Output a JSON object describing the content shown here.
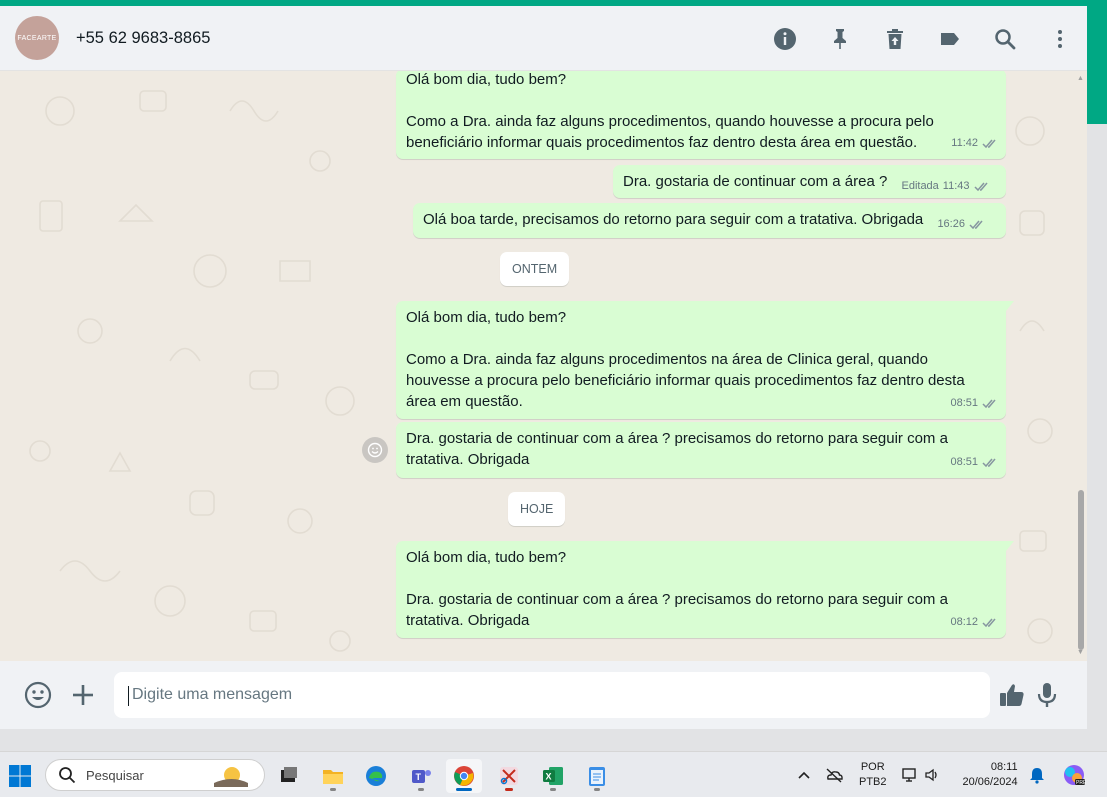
{
  "header": {
    "avatar_text": "FACEARTE",
    "contact": "+55 62 9683-8865",
    "icons": [
      "info-icon",
      "pin-icon",
      "delete-icon",
      "label-icon",
      "search-icon",
      "menu-icon"
    ]
  },
  "messages": [
    {
      "text": "Olá bom dia, tudo bem?\n\nComo a Dra. ainda faz alguns procedimentos, quando houvesse a procura pelo beneficiário informar quais procedimentos faz dentro desta área em questão.",
      "time": "11:42"
    },
    {
      "text": "Dra. gostaria de continuar com a área ?",
      "edited": "Editada",
      "time": "11:43"
    },
    {
      "text": "Olá boa tarde, precisamos do retorno para seguir com a tratativa. Obrigada",
      "time": "16:26"
    },
    {
      "text": "Olá bom dia, tudo bem?\n\nComo a Dra. ainda faz alguns procedimentos na área de Clinica geral, quando houvesse a procura pelo beneficiário informar quais procedimentos faz dentro desta área em questão.",
      "time": "08:51"
    },
    {
      "text": "Dra. gostaria de continuar com a área ? precisamos do retorno para seguir com a tratativa. Obrigada",
      "time": "08:51"
    },
    {
      "text": "Olá bom dia, tudo bem?\n\nDra. gostaria de continuar com a área ? precisamos do retorno para seguir com a tratativa. Obrigada",
      "time": "08:12"
    }
  ],
  "date_chips": {
    "yesterday": "ONTEM",
    "today": "HOJE"
  },
  "composer": {
    "placeholder": "Digite uma mensagem"
  },
  "taskbar": {
    "search_label": "Pesquisar",
    "lang_line1": "POR",
    "lang_line2": "PTB2",
    "time": "08:11",
    "date": "20/06/2024"
  },
  "colors": {
    "accent": "#00a884",
    "bubble_out": "#d9fdd3",
    "chat_bg": "#efeae2",
    "tick_gray": "#8696a0"
  }
}
